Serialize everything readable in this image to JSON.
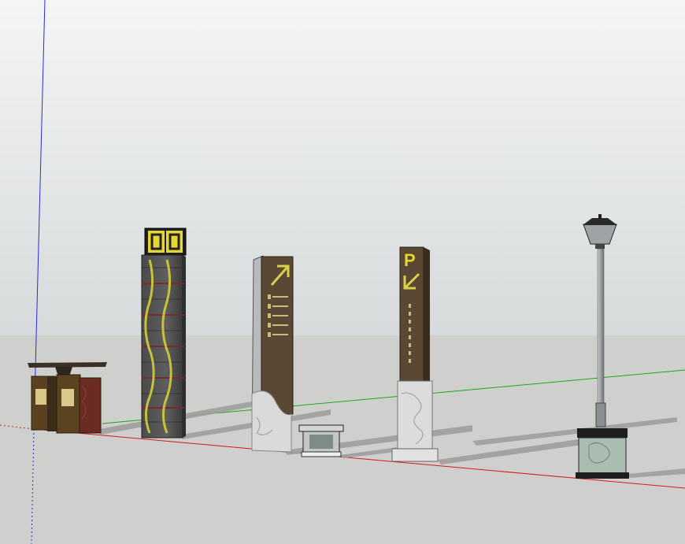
{
  "scene": {
    "sky_top": "#f2f3f3",
    "sky_bottom": "#d7dbdb",
    "ground": "#cecfcd",
    "axis_red": "#d21a1a",
    "axis_green": "#1aa81a",
    "axis_blue": "#2b2bd6"
  },
  "objects": {
    "waste_bin": {
      "icon": "twin-waste-bin-icon"
    },
    "pillar": {
      "icon": "ornamental-pillar-icon"
    },
    "directory_sign": {
      "icon": "directory-sign-icon"
    },
    "small_planter": {
      "icon": "planter-icon"
    },
    "parking_sign": {
      "icon": "parking-sign-icon",
      "letter": "P"
    },
    "lamp_post": {
      "icon": "street-lamp-icon"
    }
  }
}
